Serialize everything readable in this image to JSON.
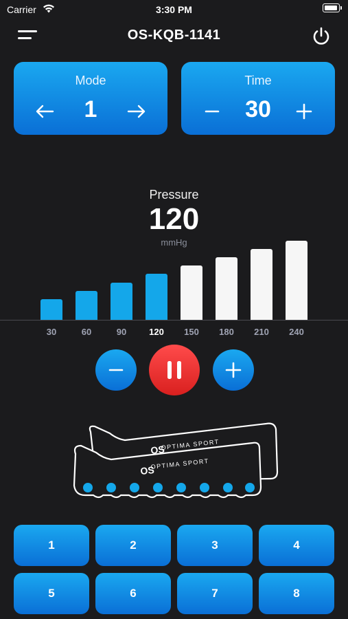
{
  "status_bar": {
    "carrier": "Carrier",
    "time": "3:30 PM"
  },
  "header": {
    "title": "OS-KQB-1141"
  },
  "mode": {
    "label": "Mode",
    "value": "1"
  },
  "time_setting": {
    "label": "Time",
    "value": "30",
    "minus": "−",
    "plus": "+"
  },
  "pressure": {
    "label": "Pressure",
    "value": "120",
    "unit": "mmHg",
    "levels": [
      "30",
      "60",
      "90",
      "120",
      "150",
      "180",
      "210",
      "240"
    ],
    "selected_index": 3
  },
  "controls": {
    "minus": "−",
    "plus": "+"
  },
  "boots": {
    "brand_text": "OPTIMA SPORT",
    "logo": "OS"
  },
  "zones": [
    "1",
    "2",
    "3",
    "4",
    "5",
    "6",
    "7",
    "8"
  ],
  "colors": {
    "accent": "#14a7ea",
    "pause": "#e52b2b",
    "background": "#1b1b1d"
  }
}
